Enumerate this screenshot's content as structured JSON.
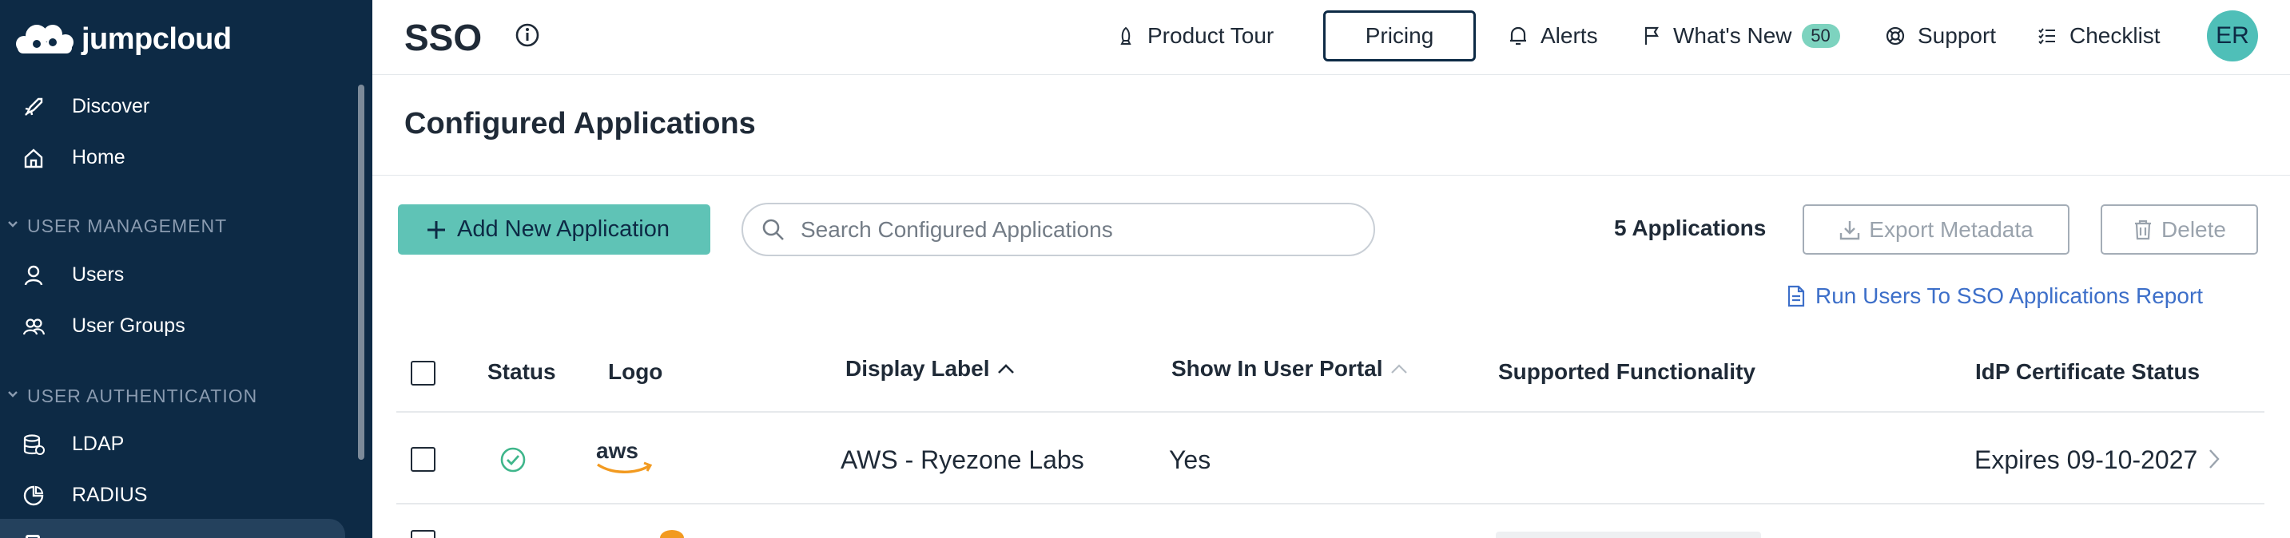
{
  "brand": {
    "name": "jumpcloud"
  },
  "sidebar": {
    "items": [
      {
        "label": "Discover",
        "icon": "rocket-icon"
      },
      {
        "label": "Home",
        "icon": "home-icon"
      }
    ],
    "sections": [
      {
        "title": "USER MANAGEMENT",
        "items": [
          {
            "label": "Users",
            "icon": "user-icon"
          },
          {
            "label": "User Groups",
            "icon": "user-groups-icon"
          }
        ]
      },
      {
        "title": "USER AUTHENTICATION",
        "items": [
          {
            "label": "LDAP",
            "icon": "ldap-database-icon"
          },
          {
            "label": "RADIUS",
            "icon": "radius-icon"
          }
        ]
      }
    ]
  },
  "header": {
    "title": "SSO",
    "product_tour": "Product Tour",
    "pricing": "Pricing",
    "alerts": "Alerts",
    "whats_new": "What's New",
    "whats_new_count": "50",
    "support": "Support",
    "checklist": "Checklist",
    "avatar_initials": "ER"
  },
  "subheader": {
    "title": "Configured Applications"
  },
  "toolbar": {
    "add_label": "Add New Application",
    "search_placeholder": "Search Configured Applications",
    "count_label": "5 Applications",
    "export_label": "Export Metadata",
    "delete_label": "Delete",
    "report_link": "Run Users To SSO Applications Report"
  },
  "table": {
    "columns": {
      "status": "Status",
      "logo": "Logo",
      "display_label": "Display Label",
      "show_in_portal": "Show In User Portal",
      "functionality": "Supported Functionality",
      "cert_status": "IdP Certificate Status"
    },
    "rows": [
      {
        "status": "active",
        "logo": "aws",
        "display_label": "AWS - Ryezone Labs",
        "show_in_portal": "Yes",
        "functionality": "",
        "cert_status": "Expires 09-10-2027"
      }
    ]
  },
  "colors": {
    "sidebar": "#0d2a45",
    "accent": "#5fc3b6",
    "link": "#3d6fc9",
    "status_ok": "#3fb68b",
    "aws_orange": "#f29a20"
  }
}
